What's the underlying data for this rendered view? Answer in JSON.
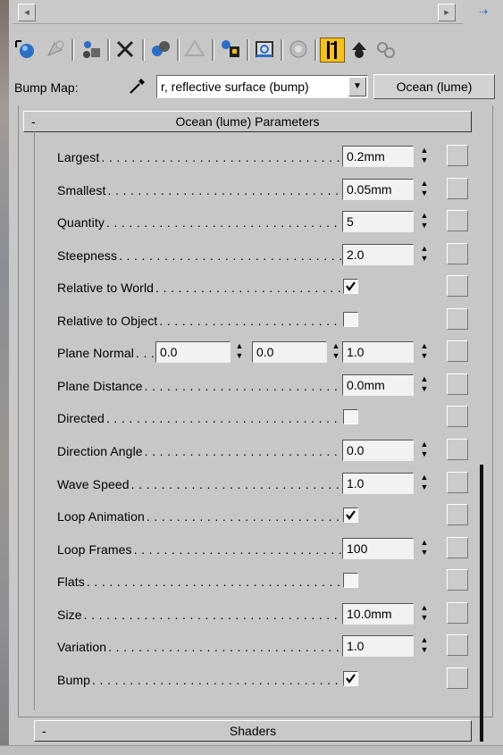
{
  "scrollbar": {
    "left_arrow": "◂",
    "right_arrow": "▸",
    "corner_icon": "⇢"
  },
  "toolbar": {
    "icons": [
      "get-material-icon",
      "put-to-scene-icon",
      "assign-to-selection-icon",
      "delete-icon",
      "make-unique-icon",
      "put-to-library-icon",
      "material-effects-icon",
      "show-map-icon",
      "show-end-result-icon",
      "go-to-parent-icon",
      "go-forward-icon",
      "pick-material-icon"
    ],
    "active_icon": "show-end-result-icon"
  },
  "bump": {
    "label": "Bump Map:",
    "map_value": "r, reflective surface (bump)",
    "map_button": "Ocean (lume)"
  },
  "rollout": {
    "collapse": "-",
    "title": "Ocean (lume) Parameters"
  },
  "params": [
    {
      "label": "Largest",
      "type": "spinner",
      "value": "0.2mm"
    },
    {
      "label": "Smallest",
      "type": "spinner",
      "value": "0.05mm"
    },
    {
      "label": "Quantity",
      "type": "spinner",
      "value": "5"
    },
    {
      "label": "Steepness",
      "type": "spinner",
      "value": "2.0"
    },
    {
      "label": "Relative to World",
      "type": "checkbox",
      "checked": true
    },
    {
      "label": "Relative to Object",
      "type": "checkbox",
      "checked": false
    },
    {
      "label": "Plane Normal",
      "type": "triple",
      "values": [
        "0.0",
        "0.0",
        "1.0"
      ]
    },
    {
      "label": "Plane Distance",
      "type": "spinner",
      "value": "0.0mm"
    },
    {
      "label": "Directed",
      "type": "checkbox",
      "checked": false
    },
    {
      "label": "Direction Angle",
      "type": "spinner",
      "value": "0.0"
    },
    {
      "label": "Wave Speed",
      "type": "spinner",
      "value": "1.0"
    },
    {
      "label": "Loop Animation",
      "type": "checkbox",
      "checked": true
    },
    {
      "label": "Loop Frames",
      "type": "spinner",
      "value": "100"
    },
    {
      "label": "Flats",
      "type": "checkbox",
      "checked": false
    },
    {
      "label": "Size",
      "type": "spinner",
      "value": "10.0mm"
    },
    {
      "label": "Variation",
      "type": "spinner",
      "value": "1.0"
    },
    {
      "label": "Bump",
      "type": "checkbox",
      "checked": true
    }
  ],
  "shaders": {
    "collapse": "-",
    "title": "Shaders"
  }
}
